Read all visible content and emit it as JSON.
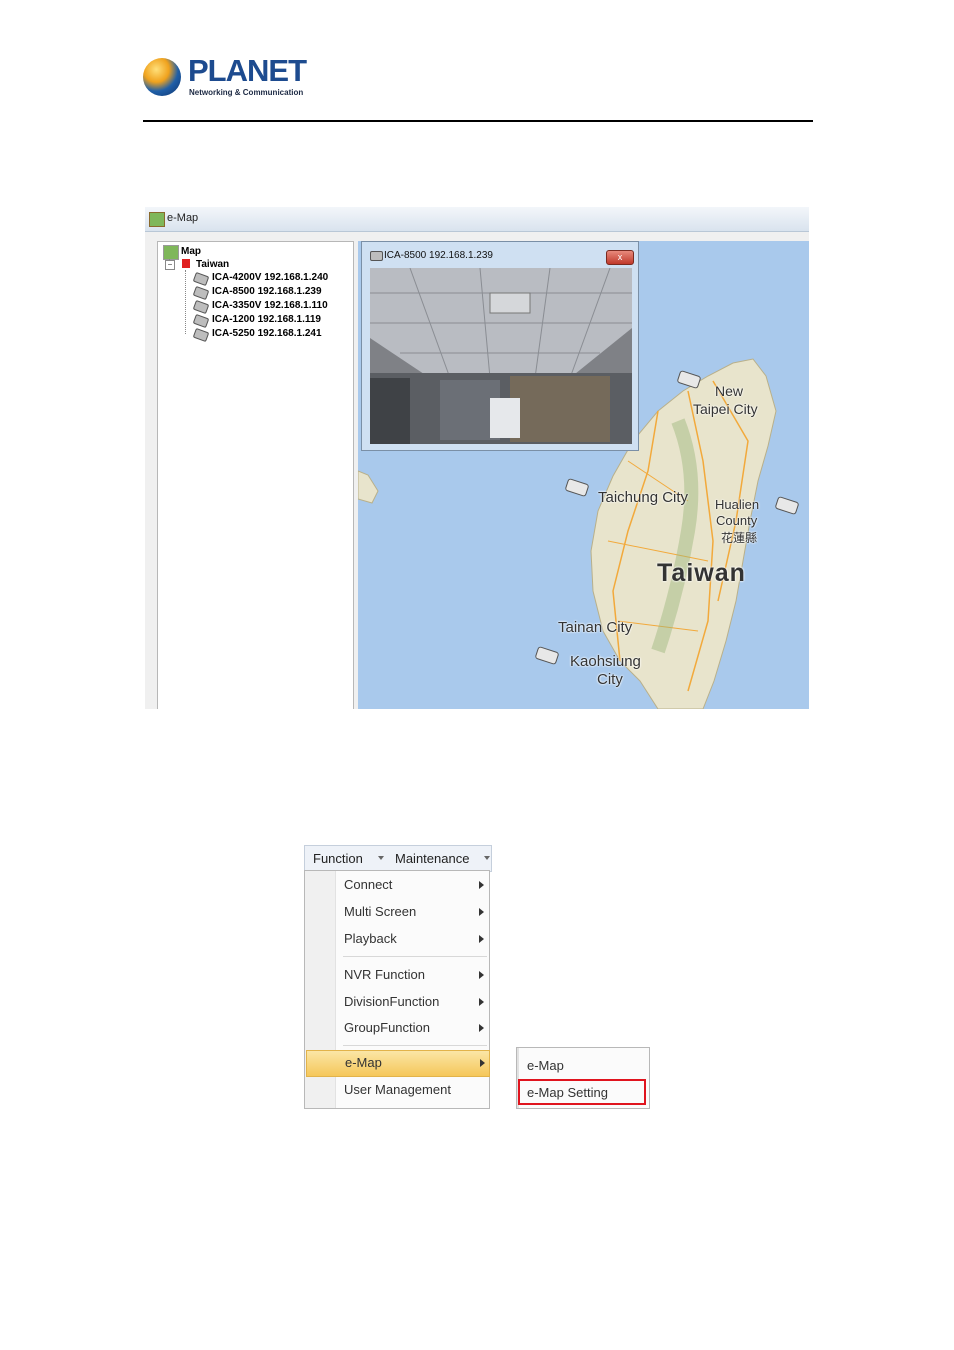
{
  "header": {
    "brand": "PLANET",
    "tagline": "Networking & Communication"
  },
  "emap_window": {
    "title": "e-Map",
    "tree": {
      "root": "Map",
      "region": "Taiwan",
      "cameras": [
        "ICA-4200V 192.168.1.240",
        "ICA-8500 192.168.1.239",
        "ICA-3350V 192.168.1.110",
        "ICA-1200 192.168.1.119",
        "ICA-5250 192.168.1.241"
      ]
    },
    "preview": {
      "title": "ICA-8500 192.168.1.239",
      "close": "x"
    },
    "map_labels": {
      "new_taipei_1": "New",
      "new_taipei_2": "Taipei City",
      "taichung": "Taichung City",
      "hualien_1": "Hualien",
      "hualien_2": "County",
      "hualien_3": "花蓮縣",
      "taiwan": "Taiwan",
      "tainan": "Tainan City",
      "kaohsiung_1": "Kaohsiung",
      "kaohsiung_2": "City"
    },
    "colors": {
      "sea": "#a9c9ec",
      "land": "#e8e4cc",
      "roads": "#f2a93b"
    }
  },
  "menu": {
    "bar": [
      "Function",
      "Maintenance"
    ],
    "items": [
      "Connect",
      "Multi Screen",
      "Playback",
      "NVR Function",
      "DivisionFunction",
      "GroupFunction",
      "e-Map",
      "User Management"
    ],
    "submenu": [
      "e-Map",
      "e-Map Setting"
    ],
    "highlight_color": "#e0141e"
  }
}
